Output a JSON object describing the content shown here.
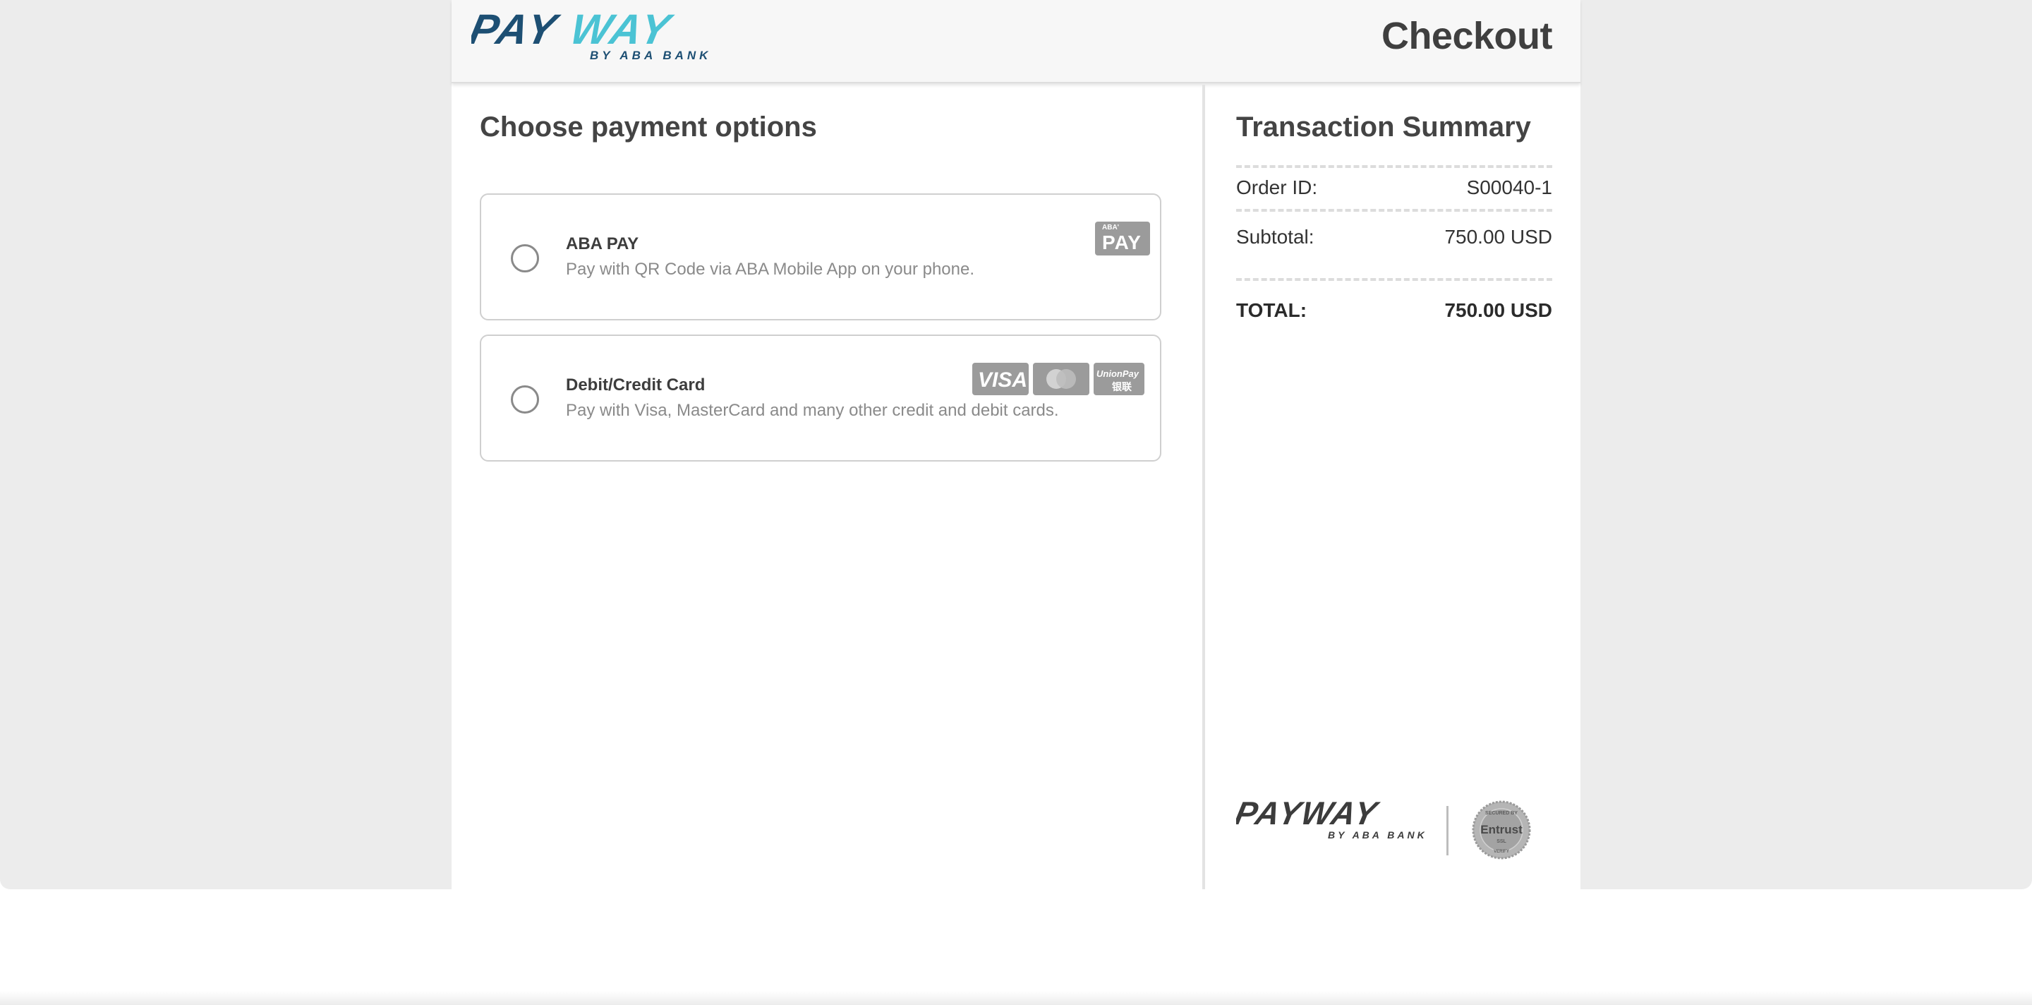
{
  "header": {
    "logo_main": "PAYWAY",
    "logo_sub": "BY ABA BANK",
    "title": "Checkout"
  },
  "payment": {
    "title": "Choose payment options",
    "options": [
      {
        "title": "ABA PAY",
        "description": "Pay with QR Code via ABA Mobile App on your phone.",
        "badge_small": "ABA'",
        "badge_large": "PAY"
      },
      {
        "title": "Debit/Credit Card",
        "description": "Pay with Visa, MasterCard and many other credit and debit cards.",
        "cards": [
          "VISA",
          "UnionPay",
          "银联"
        ]
      }
    ]
  },
  "summary": {
    "title": "Transaction Summary",
    "order_id_label": "Order ID:",
    "order_id_value": "S00040-1",
    "subtotal_label": "Subtotal:",
    "subtotal_value": "750.00 USD",
    "total_label": "TOTAL:",
    "total_value": "750.00 USD"
  },
  "footer": {
    "logo_main": "PAYWAY",
    "logo_sub": "BY ABA BANK",
    "seal_top": "SECURED BY",
    "seal_main": "Entrust",
    "seal_sub": "SSL",
    "seal_bottom": "VERIFY"
  },
  "colors": {
    "brand_dark": "#1d4f73",
    "brand_light": "#4bc3d4",
    "logo_gray": "#3c3c3c",
    "badge_gray": "#9b9b9b"
  }
}
